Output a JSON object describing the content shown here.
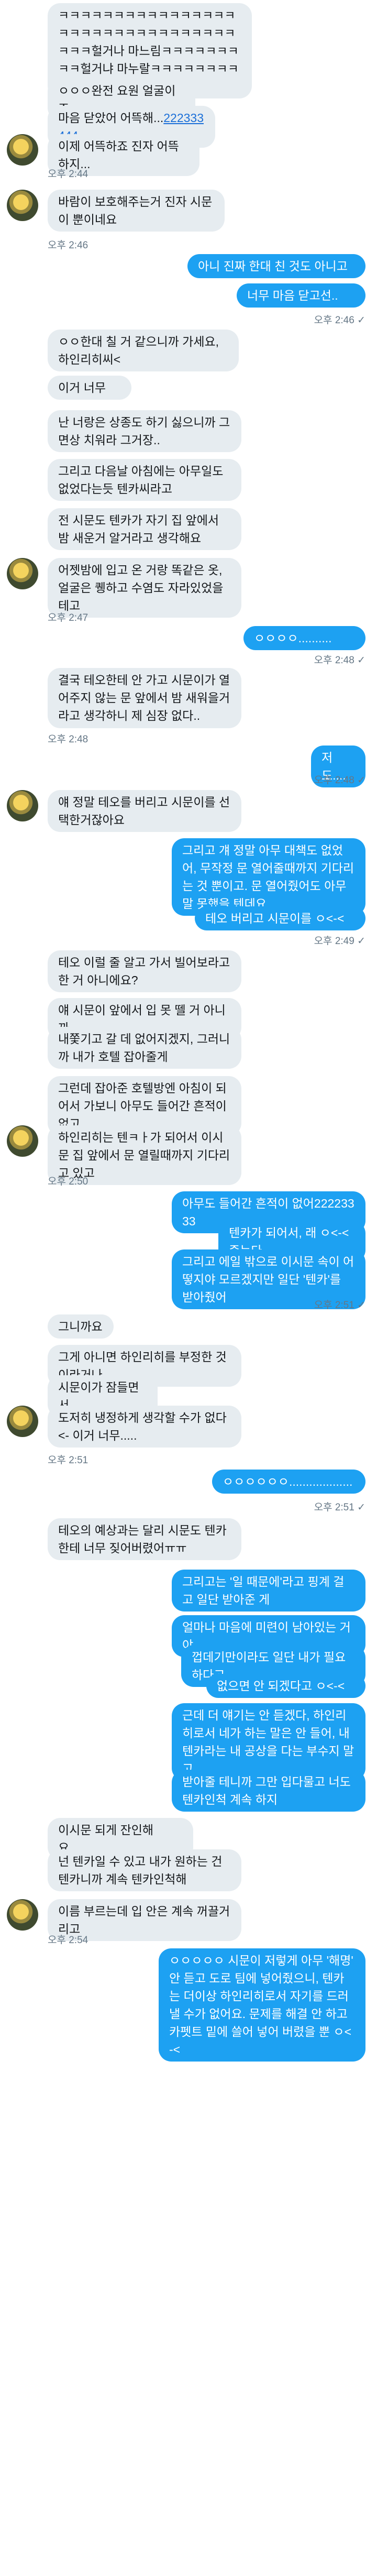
{
  "messages": [
    {
      "dir": "in",
      "text": "ㅋㅋㅋㅋㅋㅋㅋㅋㅋㅋㅋㅋㅋㅋㅋㅋㅋㅋㅋㅋㅋㅋㅋㅋㅋㅋㅋㅋㅋㅋㅋㅋㅋㅋㅋ헐거나 마느림ㅋㅋㅋㅋㅋㅋㅋㅋㅋ헐거냐 마누랄ㅋㅋㅋㅋㅋㅋㅋㅋㅋㅋㅋㅋ"
    },
    {
      "dir": "in",
      "text": "ㅇㅇㅇ완전 요원 얼굴이죠"
    },
    {
      "dir": "in",
      "text": "마음 닫았어 어뜩해...",
      "link": "222333444"
    },
    {
      "dir": "in",
      "text": "이제 어뜩하죠 진자 어뜩하지..."
    },
    {
      "dir": "ts",
      "text": "오후 2:44"
    },
    {
      "dir": "in",
      "text": "바람이 보호해주는거 진자 시문이 뿐이네요"
    },
    {
      "dir": "ts",
      "text": "오후 2:46"
    },
    {
      "dir": "out",
      "text": "아니 진짜 한대 친 것도 아니고"
    },
    {
      "dir": "out",
      "text": "너무 마음 닫고선.."
    },
    {
      "dir": "ts",
      "text": "오후 2:46 ✓"
    },
    {
      "dir": "in",
      "text": "ㅇㅇ한대 칠 거 같으니까 가세요, 하인리히씨<"
    },
    {
      "dir": "in",
      "text": "이거 너무"
    },
    {
      "dir": "in",
      "text": "난 너랑은 상종도 하기 싫으니까 그 면상 치워라 그거장.."
    },
    {
      "dir": "in",
      "text": "그리고 다음날 아침에는 아무일도 없었다는듯 텐카씨라고"
    },
    {
      "dir": "in",
      "text": "전 시문도 텐카가 자기 집 앞에서 밤 새운거 알거라고 생각해요"
    },
    {
      "dir": "in",
      "text": "어젯밤에 입고 온 거랑 똑같은 옷, 얼굴은 퀭하고 수염도 자라있었을테고"
    },
    {
      "dir": "ts",
      "text": "오후 2:47"
    },
    {
      "dir": "out",
      "text": "ㅇㅇㅇㅇ.........."
    },
    {
      "dir": "ts",
      "text": "오후 2:48 ✓"
    },
    {
      "dir": "in",
      "text": "결국 테오한테 안 가고 시문이가 열어주지 않는 문 앞에서 밤 새워을거라고 생각하니 제 심장 없다.."
    },
    {
      "dir": "ts",
      "text": "오후 2:48"
    },
    {
      "dir": "out",
      "text": "저도...."
    },
    {
      "dir": "ts",
      "text": "오후 2:48 ✓"
    },
    {
      "dir": "in",
      "text": "얘 정말 테오를 버리고 시문이를 선택한거잖아요"
    },
    {
      "dir": "out",
      "text": "그리고 걔 정말 아무 대책도 없었어, 무작정 문 열어줄때까지 기다리는 것 뿐이고. 문 열어줬어도 아무 말 못했을 텐데요"
    },
    {
      "dir": "out",
      "text": "테오 버리고 시문이를 ㅇ<-<"
    },
    {
      "dir": "ts",
      "text": "오후 2:49 ✓"
    },
    {
      "dir": "in",
      "text": "테오 이럴 줄 알고 가서 빌어보라고 한 거 아니에요?"
    },
    {
      "dir": "in",
      "text": "얘 시문이 앞에서 입 못 뗄 거 아니까"
    },
    {
      "dir": "in",
      "text": "내쫓기고 갈 데 없어지겠지, 그러니까 내가 호텔 잡아줄게"
    },
    {
      "dir": "in",
      "text": "그런데 잡아준 호텔방엔 아침이 되어서 가보니 아무도 들어간 흔적이 없고"
    },
    {
      "dir": "in",
      "text": "하인리히는 텐ㅋㅏ가 되어서 이시문 집 앞에서 문 열릴때까지 기다리고 있고"
    },
    {
      "dir": "ts",
      "text": "오후 2:50"
    },
    {
      "dir": "out",
      "text": "아무도 들어간 흔적이 없어22223333"
    },
    {
      "dir": "out",
      "text": "텐카가 되어서, 래 ㅇ<-< 죽는다"
    },
    {
      "dir": "out",
      "text": "그리고 에일 밖으로 이시문 속이 어떻지야 모르겠지만 일단 '텐카'를 받아줬어"
    },
    {
      "dir": "ts",
      "text": "오후 2:51 ✓"
    },
    {
      "dir": "in",
      "text": "그니까요"
    },
    {
      "dir": "in",
      "text": "그게 아니면 하인리히를 부정한 것이라거나"
    },
    {
      "dir": "in",
      "text": "시문이가 잠들면서"
    },
    {
      "dir": "in",
      "text": "도저히 냉정하게 생각할 수가 없다<- 이거 너무....."
    },
    {
      "dir": "ts",
      "text": "오후 2:51"
    },
    {
      "dir": "out",
      "text": "ㅇㅇㅇㅇㅇㅇ..................."
    },
    {
      "dir": "ts",
      "text": "오후 2:51 ✓"
    },
    {
      "dir": "in",
      "text": "테오의 예상과는 달리 시문도 텐카한테 너무 짖어버렸어ㅠㅠ"
    },
    {
      "dir": "out",
      "text": "그리고는 '일 때문에'라고 핑계 걸고 일단 받아준 게"
    },
    {
      "dir": "out",
      "text": "얼마나 마음에 미련이 남아있는 거야"
    },
    {
      "dir": "out",
      "text": "껍데기만이라도 일단 내가 필요하다고"
    },
    {
      "dir": "out",
      "text": "없으면 안 되겠다고 ㅇ<-<"
    },
    {
      "dir": "out",
      "text": "근데 더 얘기는 안 듣겠다, 하인리히로서 네가 하는 말은 안 들어, 내 텐카라는 내 공상을 다는 부수지 말고"
    },
    {
      "dir": "out",
      "text": "받아줄 테니까 그만 입다물고 너도 텐카인척 계속 하지"
    },
    {
      "dir": "in",
      "text": "이시문 되게 잔인해요......"
    },
    {
      "dir": "in",
      "text": "넌 텐카일 수 있고 내가 원하는 건 텐카니까 계속 텐카인척해"
    },
    {
      "dir": "in",
      "text": "이름 부르는데 입 안은 계속 꺼끌거리고"
    },
    {
      "dir": "ts",
      "text": "오후 2:54"
    },
    {
      "dir": "out",
      "text": "ㅇㅇㅇㅇㅇ 시문이 저렇게 아무 '해명' 안 듣고 도로 팀에 넣어줬으니, 텐카는 더이상 하인리히로서 자기를 드러낼 수가 없어요. 문제를 해결 안 하고 카펫트 밑에 쓸어 넣어 버렸을 뿐 ㅇ<-<"
    }
  ]
}
